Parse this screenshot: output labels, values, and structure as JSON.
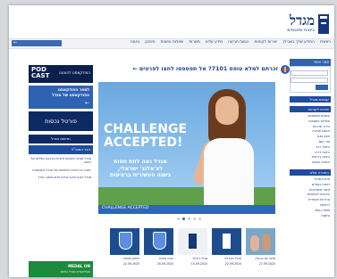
{
  "brand": {
    "name": "מגדל",
    "tagline": "ביטוח ופיננסים"
  },
  "nav": {
    "items": [
      "ראשית",
      "המידע שלך בשבילך",
      "שירות לקוחות",
      "הגשת תביעה",
      "מידע עלינו",
      "משרות",
      "שאלות נפוצות",
      "חיסכון",
      "ביטוח"
    ],
    "search_arrow": "←"
  },
  "right_sidebar": {
    "login_head": "אזור אישי",
    "blue_bar_1": "קבוצת מגדל",
    "list_head": "שירות לקוחות",
    "list": [
      "טפסים ומסמכים",
      "שאלות ותשובות",
      "בירור פרטים",
      "הגשת תביעה",
      "מצא סוכן",
      "צור קשר",
      "ביטוח רכב",
      "ביטוח דירה",
      "ביטוח בריאות",
      "הפיכת הסכם"
    ],
    "blue_bar_2": "החברה שלנו",
    "list2": [
      "אודות מגדל",
      "דוחות כספיים",
      "קשרי משקיעים",
      "הודעות לעיתונות",
      "אחריות תאגידית",
      "דרושים",
      "מפת האתר",
      "נגישות"
    ]
  },
  "promo": {
    "text": "זכרתם למלא טופס 7101? אל תפספסו לחצו לפרטים ←"
  },
  "banner": {
    "headline_1": "CHALLENGE",
    "headline_2": "ACCEPTED!",
    "copy_lines": [
      "מגדל גאה לתת חסות",
      "לצ'אלנג' ישראלי,",
      "בשנה העשירית ברציפות"
    ],
    "footer": "CHALLENGE ACCEPTED",
    "dots": 5,
    "active_dot": 1
  },
  "thumbnails": [
    {
      "kind": "photo",
      "caption_1": "שיחה עם הנהלה",
      "caption_2": "27.09.2020"
    },
    {
      "kind": "tower-dark",
      "caption_1": "מגדל בקהילה",
      "caption_2": "22.09.2020"
    },
    {
      "kind": "tower-light",
      "caption_1": "מגדל דיגיטל",
      "caption_2": "15.09.2020"
    },
    {
      "kind": "shield",
      "caption_1": "הגנה וביטוח",
      "caption_2": "20.09.2020"
    },
    {
      "kind": "shield",
      "caption_1": "חיסכון ופנסיה",
      "caption_2": "22.09.2020"
    }
  ],
  "left_sidebar": {
    "podcast_logo_1": "POD",
    "podcast_logo_2": "CAST",
    "podcast_text": "הפודקאסט להאזנה",
    "blue_box_lines": [
      "לספר הפודקאסט",
      "הפודקאסט של מגדל"
    ],
    "blue_box_arrow": "←",
    "dark_box": "פורטל נכסות",
    "news_head": "חדשות מגדל",
    "news_sub": "דבר המנכ\"ל",
    "news": [
      "מגדל מציגה תוצאות חיוביות ברבעון השלישי של השנה",
      "כתבה על שירות הלקוחות של מגדל בתקשורת",
      "מגדל חנכה מרכז שירות חדש בצפון הארץ"
    ],
    "green_title": "MEDAL ON",
    "green_sub": "אפליקציית מגדל בחינם"
  }
}
